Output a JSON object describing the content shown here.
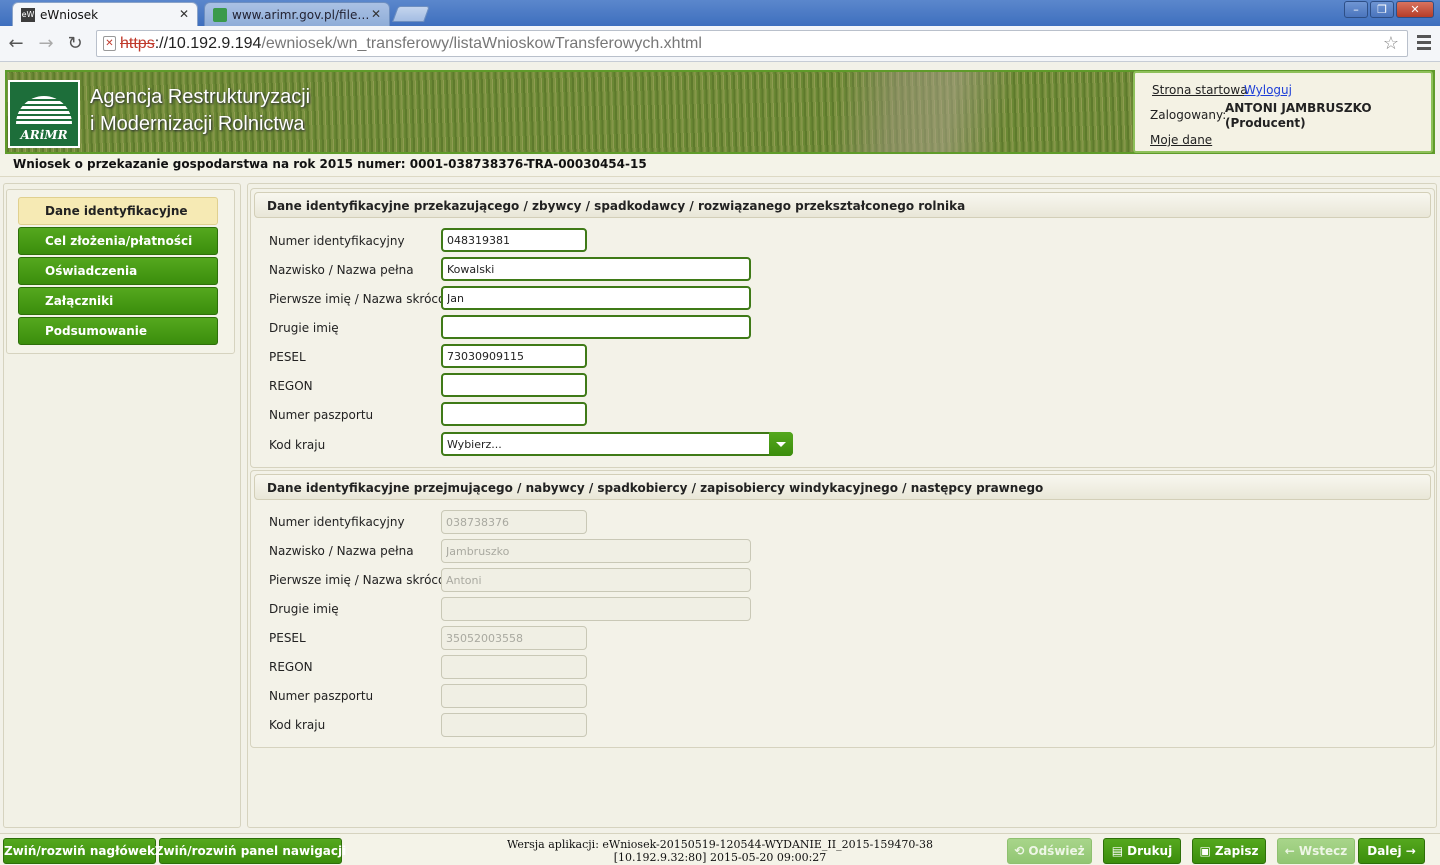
{
  "browser": {
    "tabs": [
      {
        "label": "eWniosek",
        "favicon": "eW",
        "active": true
      },
      {
        "label": "www.arimr.gov.pl/fileadmin/",
        "active": false
      }
    ],
    "url": {
      "scheme": "https",
      "host": "://10.192.9.194",
      "path": "/ewniosek/wn_transferowy/listaWnioskowTransferowych.xhtml"
    },
    "icons": {
      "back": "back-arrow-icon",
      "forward": "forward-arrow-icon",
      "reload": "reload-icon",
      "star": "bookmark-star-icon",
      "menu": "menu-icon"
    }
  },
  "header": {
    "logo_text": "ARiMR",
    "agency_line1": "Agencja Restrukturyzacji",
    "agency_line2": "i Modernizacji Rolnictwa",
    "start_link": "Strona startowa",
    "logout_link": "Wyloguj",
    "logged_label": "Zalogowany:",
    "user_name": "ANTONI JAMBRUSZKO",
    "user_role": "(Producent)",
    "my_data_link": "Moje dane"
  },
  "page_title": "Wniosek o przekazanie gospodarstwa na rok 2015 numer: 0001-038738376-TRA-00030454-15",
  "nav": {
    "items": [
      {
        "label": "Dane identyfikacyjne",
        "selected": true
      },
      {
        "label": "Cel złożenia/płatności",
        "selected": false
      },
      {
        "label": "Oświadczenia",
        "selected": false
      },
      {
        "label": "Załączniki",
        "selected": false
      },
      {
        "label": "Podsumowanie",
        "selected": false
      }
    ]
  },
  "section1": {
    "title": "Dane identyfikacyjne przekazującego / zbywcy / spadkodawcy / rozwiązanego przekształconego rolnika",
    "fields": {
      "id_number": {
        "label": "Numer identyfikacyjny",
        "value": "048319381"
      },
      "surname": {
        "label": "Nazwisko / Nazwa pełna",
        "value": "Kowalski"
      },
      "first_name": {
        "label": "Pierwsze imię / Nazwa skrócona",
        "value": "Jan"
      },
      "second_name": {
        "label": "Drugie imię",
        "value": ""
      },
      "pesel": {
        "label": "PESEL",
        "value": "73030909115"
      },
      "regon": {
        "label": "REGON",
        "value": ""
      },
      "passport": {
        "label": "Numer paszportu",
        "value": ""
      },
      "country": {
        "label": "Kod kraju",
        "value": "Wybierz..."
      }
    }
  },
  "section2": {
    "title": "Dane identyfikacyjne przejmującego / nabywcy / spadkobiercy / zapisobiercy windykacyjnego / następcy prawnego",
    "fields": {
      "id_number": {
        "label": "Numer identyfikacyjny",
        "value": "038738376"
      },
      "surname": {
        "label": "Nazwisko / Nazwa pełna",
        "value": "Jambruszko"
      },
      "first_name": {
        "label": "Pierwsze imię / Nazwa skrócona",
        "value": "Antoni"
      },
      "second_name": {
        "label": "Drugie imię",
        "value": ""
      },
      "pesel": {
        "label": "PESEL",
        "value": "35052003558"
      },
      "regon": {
        "label": "REGON",
        "value": ""
      },
      "passport": {
        "label": "Numer paszportu",
        "value": ""
      },
      "country": {
        "label": "Kod kraju",
        "value": ""
      }
    }
  },
  "footer": {
    "toggle_header": "Zwiń/rozwiń nagłówek",
    "toggle_nav": "Zwiń/rozwiń panel nawigacji",
    "version_line1": "Wersja aplikacji: eWniosek-20150519-120544-WYDANIE_II_2015-159470-38",
    "version_line2": "[10.192.9.32:80] 2015-05-20 09:00:27",
    "refresh": "Odśwież",
    "print": "Drukuj",
    "save": "Zapisz",
    "back": "Wstecz",
    "next": "Dalej"
  },
  "colors": {
    "accent_green": "#3b8d0c",
    "selected_nav": "#f6eab4",
    "link_blue": "#1d3fd8"
  }
}
